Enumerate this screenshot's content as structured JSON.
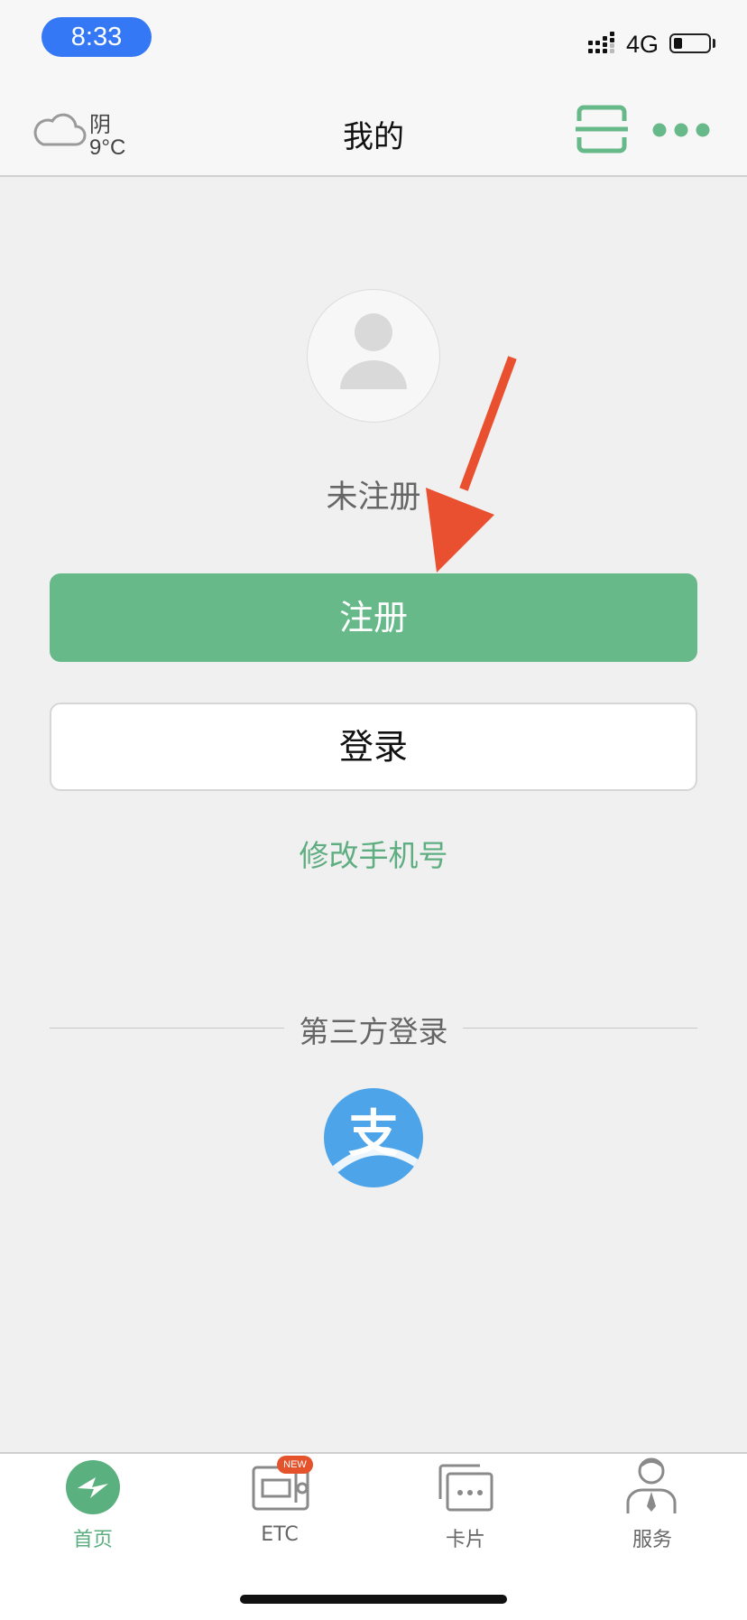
{
  "status_bar": {
    "time": "8:33",
    "network": "4G",
    "time_pill_color": "#3478f6"
  },
  "nav": {
    "weather_icon": "cloud-icon",
    "weather_condition": "阴",
    "weather_temp": "9°C",
    "title": "我的",
    "scan_icon": "scan-icon",
    "more_icon": "more-dots-icon"
  },
  "profile": {
    "avatar_icon": "user-avatar-icon",
    "status": "未注册",
    "register_label": "注册",
    "login_label": "登录",
    "change_phone_label": "修改手机号"
  },
  "third_party": {
    "label": "第三方登录",
    "alipay_icon": "alipay-icon",
    "alipay_glyph": "支"
  },
  "tabs": [
    {
      "label": "首页",
      "icon": "home-icon",
      "active": true
    },
    {
      "label": "ETC",
      "icon": "etc-device-icon",
      "badge": "NEW"
    },
    {
      "label": "卡片",
      "icon": "cards-icon"
    },
    {
      "label": "服务",
      "icon": "service-agent-icon"
    }
  ],
  "colors": {
    "accent": "#67b98a",
    "alipay": "#4ea4e9",
    "annotation_arrow": "#e9502f"
  }
}
